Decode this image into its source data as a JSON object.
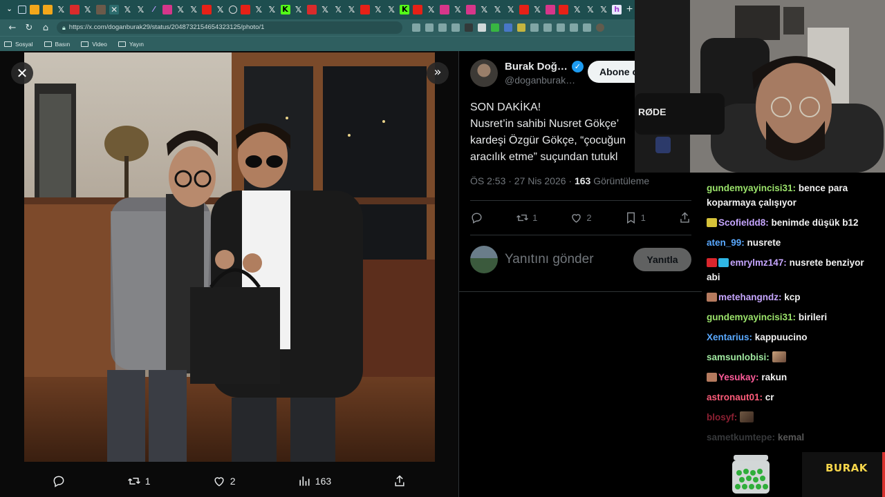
{
  "browser": {
    "url": "https://x.com/doganburak29/status/2048732154654323125/photo/1",
    "bookmarks": [
      "Sosyal",
      "Basın",
      "Video",
      "Yayın"
    ],
    "new_tab": "+"
  },
  "media": {
    "close_glyph": "✕",
    "expand_glyph": "»",
    "retweets": "1",
    "likes": "2",
    "views": "163"
  },
  "tweet": {
    "author_name": "Burak Doğ…",
    "author_handle": "@doganburak…",
    "follow_label": "Abone o",
    "lines": [
      "SON DAKİKA!",
      "Nusret’in sahibi Nusret Gökçe’",
      "kardeşi Özgür Gökçe, “çocuğun",
      "aracılık etme” suçundan tutukl"
    ],
    "time": "ÖS 2:53 · 27 Nis 2026 · ",
    "view_count": "163",
    "view_label": " Görüntüleme",
    "retweet_count": "1",
    "like_count": "2",
    "bookmark_count": "1",
    "reply_placeholder": "Yanıtını gönder",
    "reply_button": "Yanıtla"
  },
  "chat": [
    {
      "user": "gundemyayincisi31",
      "color": "#9be36b",
      "text": "bence para koparmaya çalışıyor",
      "badges": []
    },
    {
      "user": "Scofieldd8",
      "color": "#c6a6ff",
      "text": "benimde düşük b12",
      "badges": [
        "#d6c23a"
      ]
    },
    {
      "user": "aten_99",
      "color": "#5aa9ff",
      "text": "nusrete",
      "badges": []
    },
    {
      "user": "emrylmz147",
      "color": "#c6a6ff",
      "text": "nusrete benziyor abi",
      "badges": [
        "#d9262d",
        "#2fb7e6"
      ]
    },
    {
      "user": "metehangndz",
      "color": "#c6a6ff",
      "text": "kcp",
      "badges": [
        "#b57a5e"
      ]
    },
    {
      "user": "gundemyayincisi31",
      "color": "#9be36b",
      "text": "birileri",
      "badges": []
    },
    {
      "user": "Xentarius",
      "color": "#5aa9ff",
      "text": "kappuucino",
      "badges": []
    },
    {
      "user": "samsunlobisi",
      "color": "#a0e8a0",
      "text": "",
      "badges": [],
      "emote": true
    },
    {
      "user": "Yesukay",
      "color": "#ff5c9a",
      "text": "rakun",
      "badges": [
        "#b57a5e"
      ]
    },
    {
      "user": "astronaut01",
      "color": "#ff5c7a",
      "text": "cr",
      "badges": []
    },
    {
      "user": "blosyf",
      "color": "#ff3b5c",
      "text": "",
      "badges": [],
      "emote": true
    },
    {
      "user": "sametkumtepe",
      "color": "#9aa0a6",
      "text": "kemal",
      "badges": []
    }
  ],
  "overlay": {
    "brand": "BURAK"
  }
}
